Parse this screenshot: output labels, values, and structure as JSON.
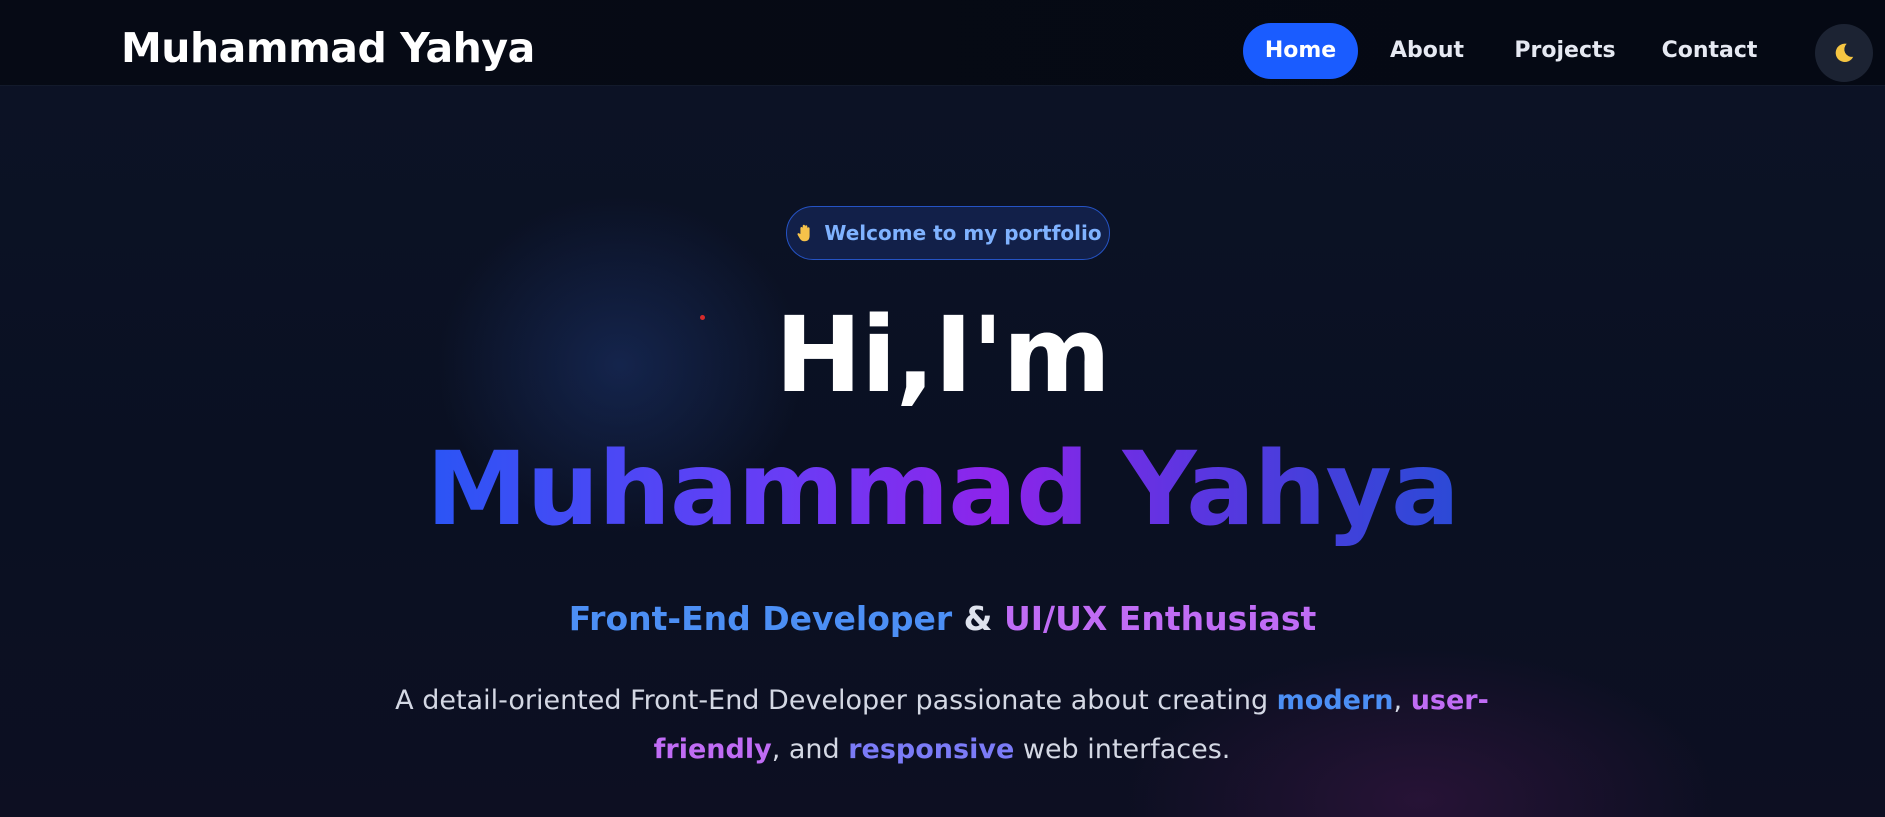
{
  "navbar": {
    "brand": "Muhammad Yahya",
    "links": [
      {
        "label": "Home",
        "active": true
      },
      {
        "label": "About",
        "active": false
      },
      {
        "label": "Projects",
        "active": false
      },
      {
        "label": "Contact",
        "active": false
      }
    ],
    "theme_toggle_icon": "moon-icon"
  },
  "hero": {
    "badge": {
      "icon": "waving-hand-icon",
      "text": "Welcome to my portfolio"
    },
    "greeting": "Hi,I'm",
    "name": "Muhammad Yahya",
    "role": {
      "part1": "Front-End Developer",
      "amp": "&",
      "part2": "UI/UX Enthusiast"
    },
    "description": {
      "text1": "A detail-oriented Front-End Developer passionate about creating ",
      "hl1": "modern",
      "sep1": ", ",
      "hl2": "user-friendly",
      "sep2": ", and ",
      "hl3": "responsive",
      "text2": " web interfaces."
    }
  },
  "colors": {
    "accent": "#1a5cff",
    "blue_text": "#4c8ff5",
    "purple_text": "#c06cf5",
    "background": "#0b1122"
  }
}
